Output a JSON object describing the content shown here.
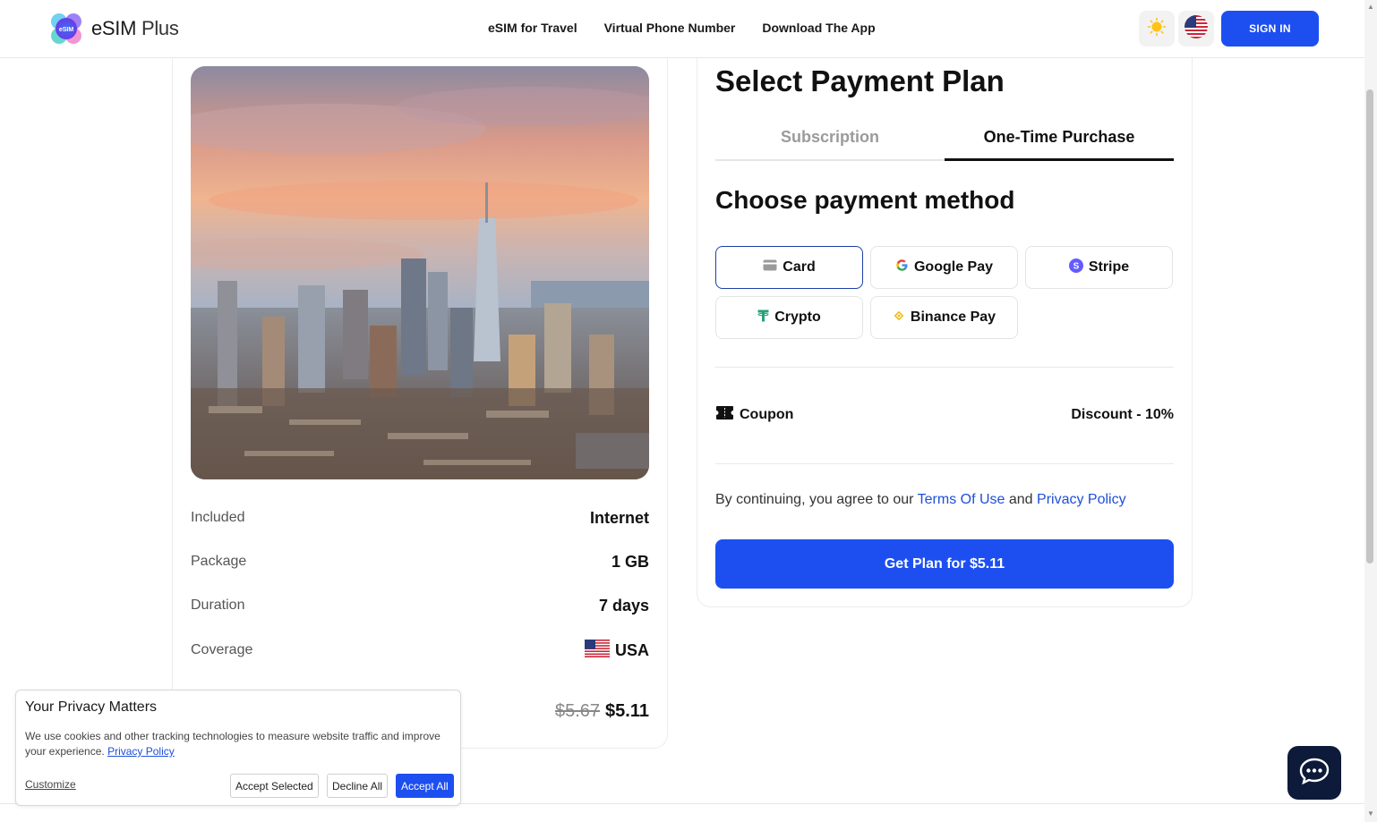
{
  "header": {
    "logo_text_main": "eSIM",
    "logo_text_sub": " Plus",
    "logo_badge": "eSIM",
    "nav": [
      "eSIM for Travel",
      "Virtual Phone Number",
      "Download The App"
    ],
    "signin_label": "SIGN IN"
  },
  "product": {
    "rows": [
      {
        "label": "Included",
        "value": "Internet"
      },
      {
        "label": "Package",
        "value": "1 GB"
      },
      {
        "label": "Duration",
        "value": "7 days"
      },
      {
        "label": "Coverage",
        "value": "USA"
      }
    ],
    "price_old": "$5.67",
    "price_new": "$5.11"
  },
  "plan": {
    "title": "Select Payment Plan",
    "tabs": [
      "Subscription",
      "One-Time Purchase"
    ],
    "active_tab": "One-Time Purchase",
    "method_title": "Choose payment method",
    "methods": [
      "Card",
      "Google Pay",
      "Stripe",
      "Crypto",
      "Binance Pay"
    ],
    "selected_method": "Card",
    "coupon_label": "Coupon",
    "discount_label": "Discount - 10%",
    "terms_prefix": "By continuing, you agree to our ",
    "terms_link": "Terms Of Use",
    "terms_and": " and ",
    "privacy_link": "Privacy Policy",
    "cta_label": "Get Plan for $5.11"
  },
  "privacy": {
    "title": "Your Privacy Matters",
    "text": "We use cookies and other tracking technologies to measure website traffic and improve your experience. ",
    "link": "Privacy Policy",
    "customize": "Customize",
    "accept_selected": "Accept Selected",
    "decline_all": "Decline All",
    "accept_all": "Accept All"
  },
  "colors": {
    "accent": "#1d4ff0",
    "link": "#1e4fd8",
    "chat_bg": "#0e1a3a"
  },
  "icons": [
    "sun-icon",
    "us-flag-icon",
    "card-icon",
    "google-icon",
    "stripe-icon",
    "tether-icon",
    "binance-icon",
    "coupon-icon",
    "chat-icon"
  ]
}
